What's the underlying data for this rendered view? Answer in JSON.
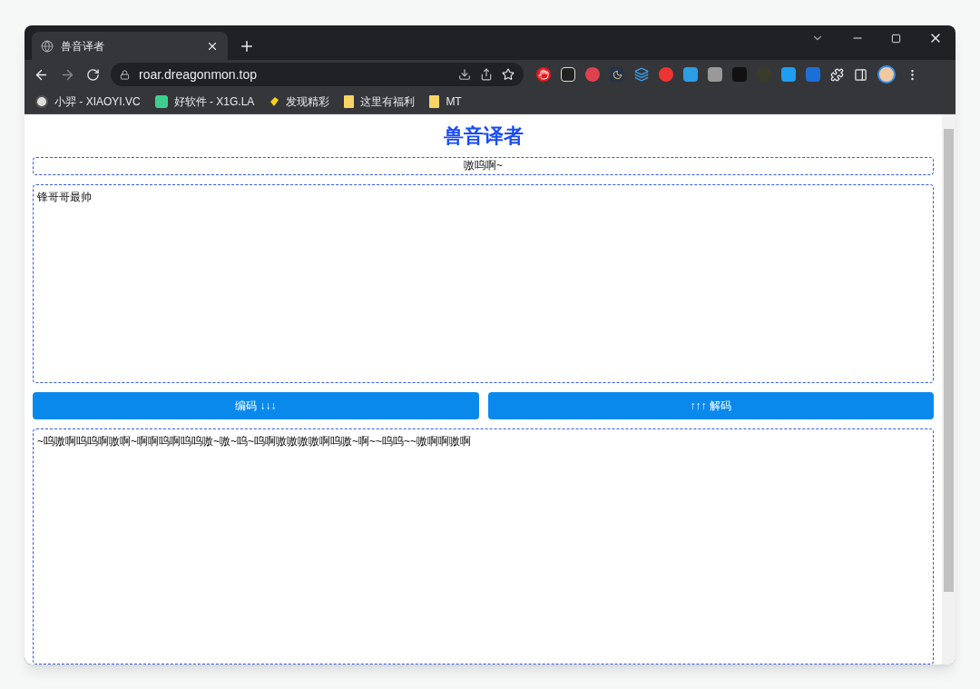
{
  "browser": {
    "tab": {
      "title": "兽音译者",
      "selected": true
    },
    "address": "roar.dreagonmon.top",
    "bookmarks": [
      {
        "label": "小羿 - XIAOYI.VC",
        "kind": "avatar"
      },
      {
        "label": "好软件 - X1G.LA",
        "kind": "app"
      },
      {
        "label": "发现精彩",
        "kind": "tag"
      },
      {
        "label": "这里有福利",
        "kind": "folder"
      },
      {
        "label": "MT",
        "kind": "folder"
      }
    ]
  },
  "page": {
    "title": "兽音译者",
    "key_field": {
      "value": "嗷呜啊~"
    },
    "input_area": {
      "value": "锋哥哥最帅"
    },
    "buttons": [
      {
        "label": "编码 ↓↓↓"
      },
      {
        "label": "↑↑↑ 解码"
      }
    ],
    "output_area": {
      "value": "~呜嗷啊呜呜啊嗷啊~啊啊呜啊呜呜嗷~嗷~呜~呜啊嗷嗷嗷嗷啊呜嗷~啊~~呜呜~~嗷啊啊嗷啊"
    }
  }
}
